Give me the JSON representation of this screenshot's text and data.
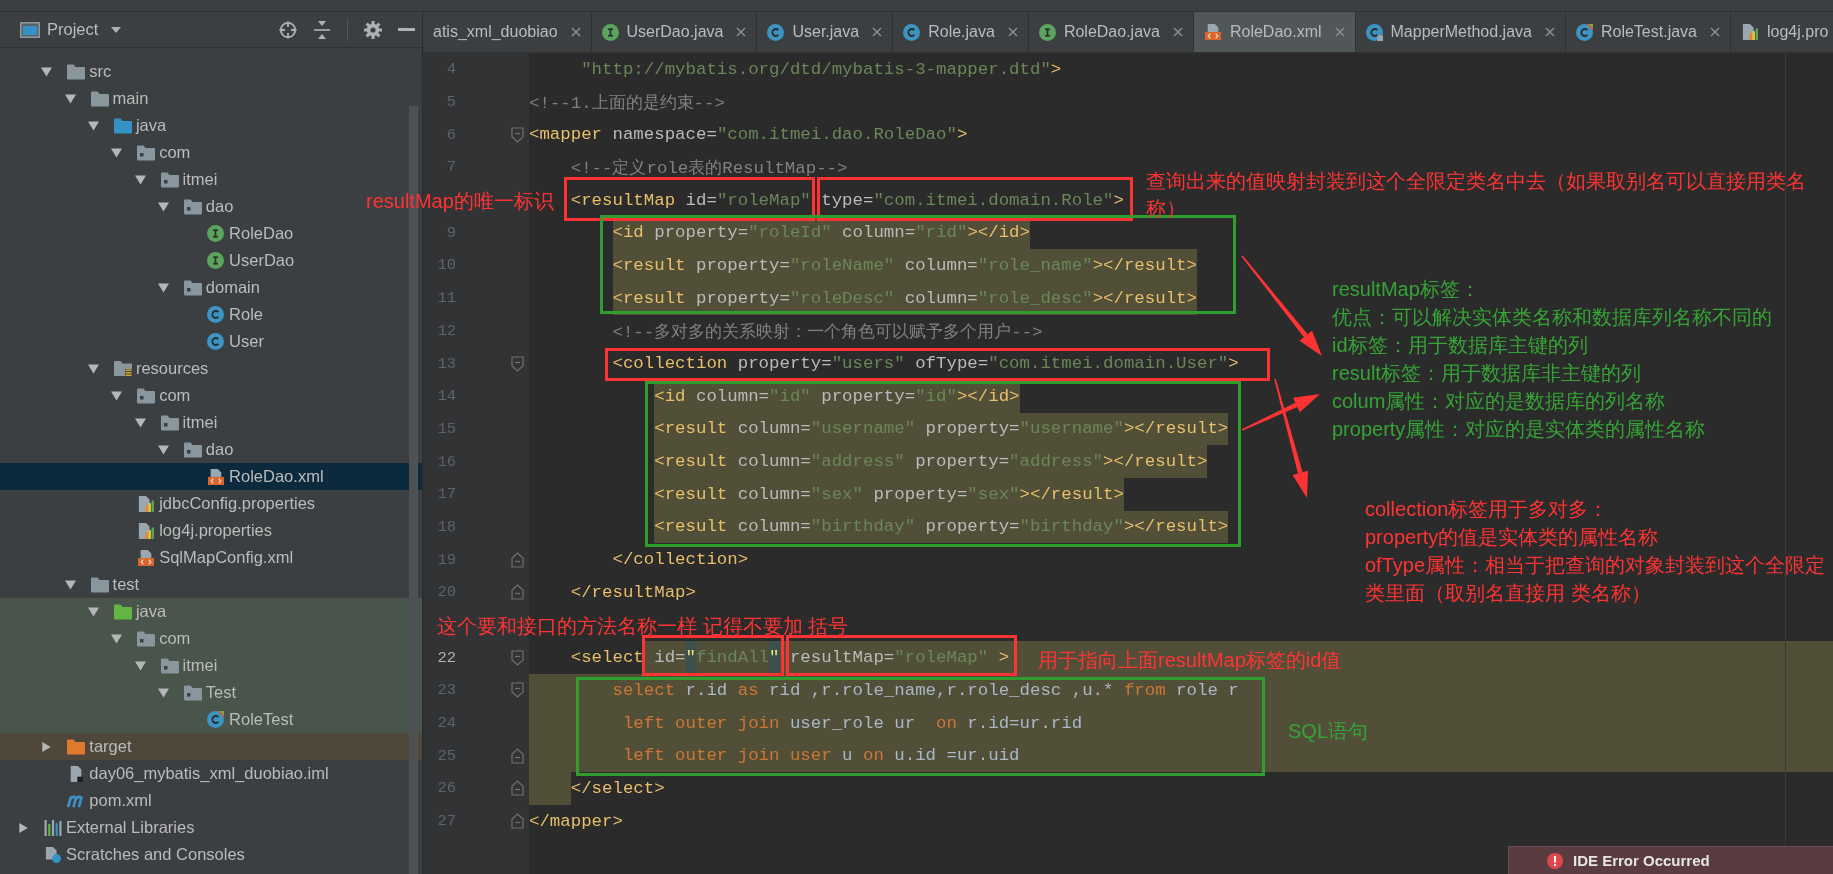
{
  "sidebar": {
    "title": "Project",
    "tree": [
      {
        "label": "src",
        "kind": "folder",
        "expanded": true,
        "selected": false,
        "children": [
          {
            "label": "main",
            "kind": "folder",
            "expanded": true,
            "selected": false,
            "children": [
              {
                "label": "java",
                "kind": "source-root",
                "expanded": true,
                "selected": false,
                "children": [
                  {
                    "label": "com",
                    "kind": "package",
                    "expanded": true,
                    "selected": false,
                    "children": [
                      {
                        "label": "itmei",
                        "kind": "package",
                        "expanded": true,
                        "selected": false,
                        "children": [
                          {
                            "label": "dao",
                            "kind": "package",
                            "expanded": true,
                            "selected": false,
                            "children": [
                              {
                                "label": "RoleDao",
                                "kind": "interface",
                                "selected": false
                              },
                              {
                                "label": "UserDao",
                                "kind": "interface",
                                "selected": false
                              }
                            ]
                          },
                          {
                            "label": "domain",
                            "kind": "package",
                            "expanded": true,
                            "selected": false,
                            "children": [
                              {
                                "label": "Role",
                                "kind": "class",
                                "selected": false
                              },
                              {
                                "label": "User",
                                "kind": "class",
                                "selected": false
                              }
                            ]
                          }
                        ]
                      }
                    ]
                  }
                ]
              },
              {
                "label": "resources",
                "kind": "resources-root",
                "expanded": true,
                "selected": false,
                "children": [
                  {
                    "label": "com",
                    "kind": "package",
                    "expanded": true,
                    "selected": false,
                    "children": [
                      {
                        "label": "itmei",
                        "kind": "package",
                        "expanded": true,
                        "selected": false,
                        "children": [
                          {
                            "label": "dao",
                            "kind": "package",
                            "expanded": true,
                            "selected": false,
                            "children": [
                              {
                                "label": "RoleDao.xml",
                                "kind": "xml",
                                "selected": true
                              }
                            ]
                          }
                        ]
                      }
                    ]
                  },
                  {
                    "label": "jdbcConfig.properties",
                    "kind": "properties",
                    "selected": false
                  },
                  {
                    "label": "log4j.properties",
                    "kind": "properties",
                    "selected": false
                  },
                  {
                    "label": "SqlMapConfig.xml",
                    "kind": "xml",
                    "selected": false
                  }
                ]
              }
            ]
          },
          {
            "label": "test",
            "kind": "folder",
            "expanded": true,
            "selected": false,
            "children": [
              {
                "label": "java",
                "kind": "test-root",
                "expanded": true,
                "selected": false,
                "children": [
                  {
                    "label": "com",
                    "kind": "package",
                    "expanded": true,
                    "selected": false,
                    "children": [
                      {
                        "label": "itmei",
                        "kind": "package",
                        "expanded": true,
                        "selected": false,
                        "children": [
                          {
                            "label": "Test",
                            "kind": "package",
                            "expanded": true,
                            "selected": false,
                            "children": [
                              {
                                "label": "RoleTest",
                                "kind": "test-class",
                                "selected": false
                              }
                            ]
                          }
                        ]
                      }
                    ]
                  }
                ]
              }
            ]
          }
        ]
      },
      {
        "label": "target",
        "kind": "excluded-folder",
        "expanded": false,
        "selected": false
      },
      {
        "label": "day06_mybatis_xml_duobiao.iml",
        "kind": "module-file",
        "selected": false
      },
      {
        "label": "pom.xml",
        "kind": "maven",
        "selected": false
      }
    ],
    "roots": [
      {
        "label": "External Libraries",
        "kind": "libraries",
        "expanded": false,
        "selected": false
      },
      {
        "label": "Scratches and Consoles",
        "kind": "scratches",
        "selected": false
      }
    ]
  },
  "editor": {
    "tabs": [
      {
        "label": "atis_xml_duobiao",
        "selected": false,
        "closable": true
      },
      {
        "label": "UserDao.java",
        "kind": "interface",
        "selected": false,
        "closable": true
      },
      {
        "label": "User.java",
        "kind": "class",
        "selected": false,
        "closable": true
      },
      {
        "label": "Role.java",
        "kind": "class",
        "selected": false,
        "closable": true
      },
      {
        "label": "RoleDao.java",
        "kind": "interface",
        "selected": false,
        "closable": true
      },
      {
        "label": "RoleDao.xml",
        "kind": "xml",
        "selected": true,
        "closable": true
      },
      {
        "label": "MapperMethod.java",
        "kind": "readonly-class",
        "selected": false,
        "closable": true
      },
      {
        "label": "RoleTest.java",
        "kind": "test-class",
        "selected": false,
        "closable": true
      },
      {
        "label": "log4j.pro",
        "kind": "properties",
        "selected": false,
        "closable": false
      }
    ],
    "lines": [
      {
        "number": "4",
        "kind": "plain",
        "current": false,
        "tokens": [
          {
            "kind": "value",
            "text": "     \"http://mybatis.org/dtd/mybatis-3-mapper.dtd\""
          },
          {
            "kind": "tag",
            "text": ">"
          }
        ]
      },
      {
        "number": "5",
        "kind": "plain",
        "current": false,
        "tokens": [
          {
            "kind": "comment",
            "text": "<!--1.上面的是约束-->"
          }
        ]
      },
      {
        "number": "6",
        "kind": "plain",
        "current": false,
        "fold_marker": {
          "kind": "start"
        },
        "tokens": [
          {
            "kind": "tag",
            "text": "<mapper"
          },
          {
            "kind": "attr",
            "text": " namespace="
          },
          {
            "kind": "value",
            "text": "\"com.itmei.dao.RoleDao\""
          },
          {
            "kind": "tag",
            "text": ">"
          }
        ]
      },
      {
        "number": "7",
        "kind": "plain",
        "current": false,
        "tokens": [
          {
            "kind": "comment",
            "text": "    <!--定义role表的ResultMap-->"
          }
        ]
      },
      {
        "kind": "plain",
        "tokens": [
          {
            "kind": "tag",
            "text": "    <resultMap"
          },
          {
            "kind": "attr",
            "text": " id="
          },
          {
            "kind": "value",
            "text": "\"roleMap\""
          },
          {
            "kind": "attr",
            "text": " type="
          },
          {
            "kind": "value",
            "text": "\"com.itmei.domain.Role\""
          },
          {
            "kind": "tag",
            "text": ">"
          }
        ]
      },
      {
        "number": "9",
        "kind": "shaded",
        "current": false,
        "tokens": [
          {
            "kind": "tag",
            "text": "        <id"
          },
          {
            "kind": "attr",
            "text": " property="
          },
          {
            "kind": "value",
            "text": "\"roleId\""
          },
          {
            "kind": "attr",
            "text": " column="
          },
          {
            "kind": "value",
            "text": "\"rid\""
          },
          {
            "kind": "tag",
            "text": "></id>"
          }
        ]
      },
      {
        "number": "10",
        "kind": "shaded",
        "current": false,
        "tokens": [
          {
            "kind": "tag",
            "text": "        <result"
          },
          {
            "kind": "attr",
            "text": " property="
          },
          {
            "kind": "value",
            "text": "\"roleName\""
          },
          {
            "kind": "attr",
            "text": " column="
          },
          {
            "kind": "value",
            "text": "\"role_name\""
          },
          {
            "kind": "tag",
            "text": "></result>"
          }
        ]
      },
      {
        "number": "11",
        "kind": "shaded",
        "current": false,
        "tokens": [
          {
            "kind": "tag",
            "text": "        <result"
          },
          {
            "kind": "attr",
            "text": " property="
          },
          {
            "kind": "value",
            "text": "\"roleDesc\""
          },
          {
            "kind": "attr",
            "text": " column="
          },
          {
            "kind": "value",
            "text": "\"role_desc\""
          },
          {
            "kind": "tag",
            "text": "></result>"
          }
        ]
      },
      {
        "number": "12",
        "kind": "plain",
        "current": false,
        "tokens": [
          {
            "kind": "comment",
            "text": "        <!--多对多的关系映射：一个角色可以赋予多个用户-->"
          }
        ]
      },
      {
        "number": "13",
        "kind": "plain",
        "current": false,
        "fold_marker": {
          "kind": "start"
        },
        "tokens": [
          {
            "kind": "tag",
            "text": "        <collection"
          },
          {
            "kind": "attr",
            "text": " property="
          },
          {
            "kind": "value",
            "text": "\"users\""
          },
          {
            "kind": "attr",
            "text": " ofType="
          },
          {
            "kind": "value",
            "text": "\"com.itmei.domain.User\""
          },
          {
            "kind": "tag",
            "text": ">"
          }
        ]
      },
      {
        "number": "14",
        "kind": "shaded",
        "current": false,
        "tokens": [
          {
            "kind": "tag",
            "text": "            <id"
          },
          {
            "kind": "attr",
            "text": " column="
          },
          {
            "kind": "value",
            "text": "\"id\""
          },
          {
            "kind": "attr",
            "text": " property="
          },
          {
            "kind": "value",
            "text": "\"id\""
          },
          {
            "kind": "tag",
            "text": "></id>"
          }
        ]
      },
      {
        "number": "15",
        "kind": "shaded",
        "current": false,
        "tokens": [
          {
            "kind": "tag",
            "text": "            <result"
          },
          {
            "kind": "attr",
            "text": " column="
          },
          {
            "kind": "value",
            "text": "\"username\""
          },
          {
            "kind": "attr",
            "text": " property="
          },
          {
            "kind": "value",
            "text": "\"username\""
          },
          {
            "kind": "tag",
            "text": "></result>"
          }
        ]
      },
      {
        "number": "16",
        "kind": "shaded",
        "current": false,
        "tokens": [
          {
            "kind": "tag",
            "text": "            <result"
          },
          {
            "kind": "attr",
            "text": " column="
          },
          {
            "kind": "value",
            "text": "\"address\""
          },
          {
            "kind": "attr",
            "text": " property="
          },
          {
            "kind": "value",
            "text": "\"address\""
          },
          {
            "kind": "tag",
            "text": "></result>"
          }
        ]
      },
      {
        "number": "17",
        "kind": "shaded",
        "current": false,
        "tokens": [
          {
            "kind": "tag",
            "text": "            <result"
          },
          {
            "kind": "attr",
            "text": " column="
          },
          {
            "kind": "value",
            "text": "\"sex\""
          },
          {
            "kind": "attr",
            "text": " property="
          },
          {
            "kind": "value",
            "text": "\"sex\""
          },
          {
            "kind": "tag",
            "text": "></result>"
          }
        ]
      },
      {
        "number": "18",
        "kind": "shaded",
        "current": false,
        "tokens": [
          {
            "kind": "tag",
            "text": "            <result"
          },
          {
            "kind": "attr",
            "text": " column="
          },
          {
            "kind": "value",
            "text": "\"birthday\""
          },
          {
            "kind": "attr",
            "text": " property="
          },
          {
            "kind": "value",
            "text": "\"birthday\""
          },
          {
            "kind": "tag",
            "text": "></result>"
          }
        ]
      },
      {
        "number": "19",
        "kind": "plain",
        "current": false,
        "fold_marker": {
          "kind": "end"
        },
        "tokens": [
          {
            "kind": "tag",
            "text": "        </collection>"
          }
        ]
      },
      {
        "number": "20",
        "kind": "plain",
        "current": false,
        "fold_marker": {
          "kind": "end"
        },
        "tokens": [
          {
            "kind": "tag",
            "text": "    </resultMap>"
          }
        ]
      },
      {
        "kind": "blank"
      },
      {
        "number": "22",
        "kind": "tail",
        "current": true,
        "fold_marker": {
          "kind": "start"
        },
        "tokens": [
          {
            "kind": "tag",
            "text": "    <select"
          },
          {
            "kind": "attr",
            "text": " id="
          },
          {
            "kind": "match",
            "text": "\""
          },
          {
            "kind": "value",
            "text": "findAll"
          },
          {
            "kind": "match",
            "text": "\""
          },
          {
            "kind": "attr",
            "text": " resultMap="
          },
          {
            "kind": "value",
            "text": "\"roleMap\""
          },
          {
            "kind": "tag",
            "text": " >"
          }
        ]
      },
      {
        "number": "23",
        "kind": "band",
        "current": false,
        "fold_marker": {
          "kind": "start"
        },
        "tokens": [
          {
            "kind": "keyword",
            "text": "        select"
          },
          {
            "kind": "text",
            "text": " r.id "
          },
          {
            "kind": "keyword",
            "text": "as"
          },
          {
            "kind": "text",
            "text": " rid ,r.role_name,r.role_desc ,u.* "
          },
          {
            "kind": "keyword",
            "text": "from"
          },
          {
            "kind": "text",
            "text": " role r"
          }
        ]
      },
      {
        "number": "24",
        "kind": "band",
        "current": false,
        "tokens": [
          {
            "kind": "keyword",
            "text": "         left outer join"
          },
          {
            "kind": "text",
            "text": " user_role ur  "
          },
          {
            "kind": "keyword",
            "text": "on"
          },
          {
            "kind": "text",
            "text": " r.id=ur.rid"
          }
        ]
      },
      {
        "number": "25",
        "kind": "band",
        "current": false,
        "fold_marker": {
          "kind": "end"
        },
        "tokens": [
          {
            "kind": "keyword",
            "text": "         left outer join user"
          },
          {
            "kind": "text",
            "text": " u "
          },
          {
            "kind": "keyword",
            "text": "on"
          },
          {
            "kind": "text",
            "text": " u.id =ur.uid"
          }
        ]
      },
      {
        "number": "26",
        "kind": "indent",
        "current": false,
        "fold_marker": {
          "kind": "end"
        },
        "tokens": [
          {
            "kind": "tag",
            "text": "    </select>"
          }
        ]
      },
      {
        "number": "27",
        "kind": "plain",
        "current": false,
        "fold_marker": {
          "kind": "end"
        },
        "tokens": [
          {
            "kind": "tag",
            "text": "</mapper>"
          }
        ]
      }
    ]
  },
  "annotations": {
    "notes": [
      {
        "color": "#ff3333",
        "lines": [
          "resultMap的唯一标识"
        ]
      },
      {
        "color": "#ff3333",
        "lines": [
          "查询出来的值映射封装到这个全限定类名中去（如果取别名可以直接用类名称）"
        ]
      },
      {
        "color": "#36a336",
        "lines": [
          "resultMap标签：",
          "优点：可以解决实体类名称和数据库列名称不同的",
          "id标签：用于数据库主键的列",
          "result标签：用于数据库非主键的列",
          "colum属性：对应的是数据库的列名称",
          "property属性：对应的是实体类的属性名称"
        ]
      },
      {
        "color": "#ff3333",
        "lines": [
          "collection标签用于多对多：",
          "property的值是实体类的属性名称",
          "ofType属性：相当于把查询的对象封装到这个全限定类里面（取别名直接用 类名称）"
        ]
      },
      {
        "color": "#ff3333",
        "lines": [
          "这个要和接口的方法名称一样 记得不要加 括号"
        ]
      },
      {
        "color": "#ff3333",
        "lines": [
          "用于指向上面resultMap标签的id值"
        ]
      },
      {
        "color": "#36a336",
        "lines": [
          "SQL语句"
        ]
      }
    ],
    "boxes": [
      {
        "color": "#ff3333"
      },
      {
        "color": "#ff3333"
      },
      {
        "color": "#2f9e2f"
      },
      {
        "color": "#ff3333"
      },
      {
        "color": "#2f9e2f"
      },
      {
        "color": "#ff3333"
      },
      {
        "color": "#ff3333"
      },
      {
        "color": "#2f9e2f"
      }
    ]
  },
  "notification": {
    "text": "IDE Error Occurred"
  }
}
